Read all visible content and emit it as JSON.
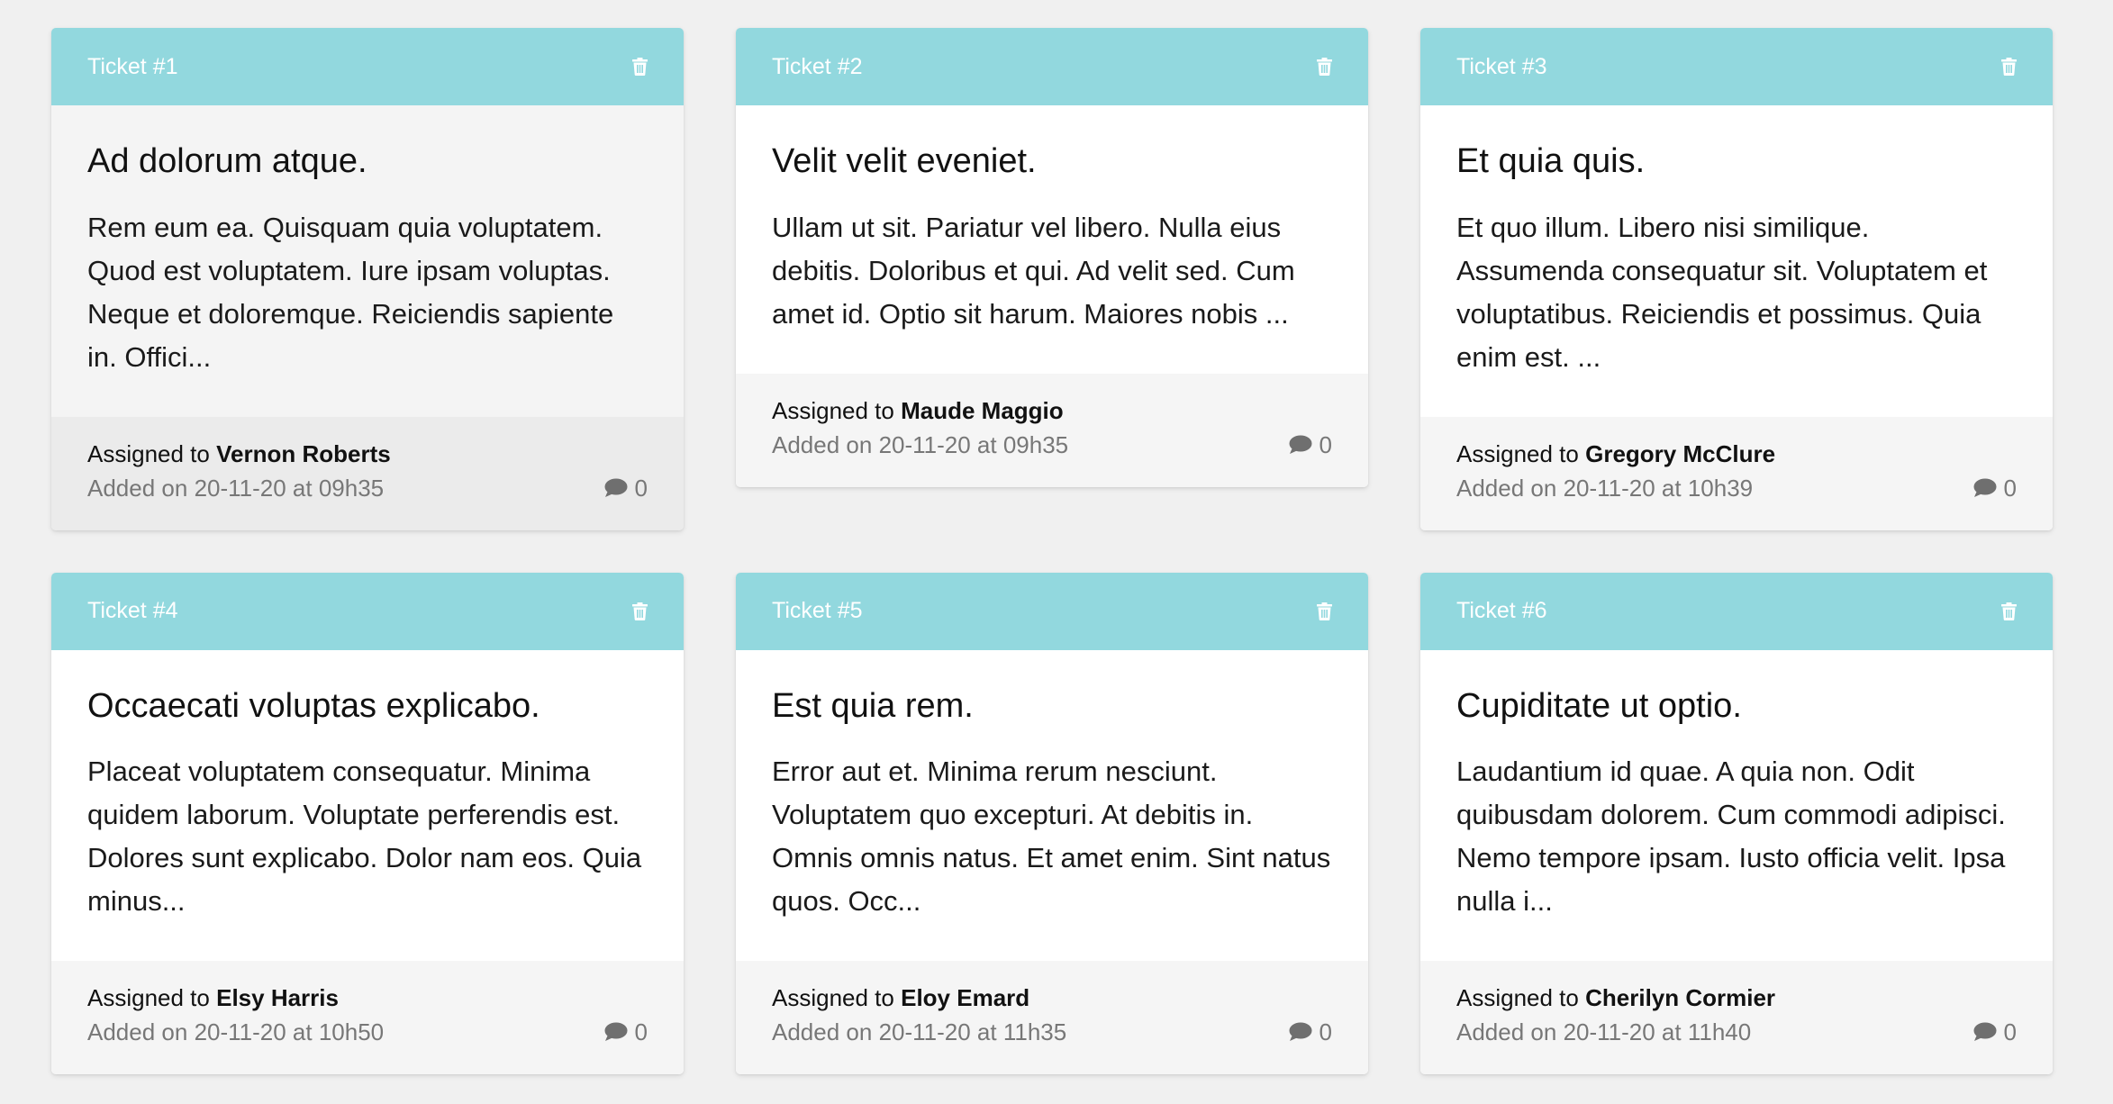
{
  "assigned_prefix": "Assigned to",
  "added_prefix": "Added on",
  "colors": {
    "header": "#92d8de",
    "page_background": "#f0f0f0",
    "footer": "#f5f5f5"
  },
  "tickets": [
    {
      "label": "Ticket #1",
      "title": "Ad dolorum atque.",
      "body": "Rem eum ea. Quisquam quia voluptatem. Quod est voluptatem. Iure ipsam voluptas. Neque et doloremque. Reiciendis sapiente in. Offici...",
      "assignee": "Vernon Roberts",
      "date": "20-11-20 at 09h35",
      "comments": "0",
      "icon": "trash-icon"
    },
    {
      "label": "Ticket #2",
      "title": "Velit velit eveniet.",
      "body": "Ullam ut sit. Pariatur vel libero. Nulla eius debitis. Doloribus et qui. Ad velit sed. Cum amet id. Optio sit harum. Maiores nobis ...",
      "assignee": "Maude Maggio",
      "date": "20-11-20 at 09h35",
      "comments": "0",
      "icon": "trash-icon"
    },
    {
      "label": "Ticket #3",
      "title": "Et quia quis.",
      "body": "Et quo illum. Libero nisi similique. Assumenda consequatur sit. Voluptatem et voluptatibus. Reiciendis et possimus. Quia enim est. ...",
      "assignee": "Gregory McClure",
      "date": "20-11-20 at 10h39",
      "comments": "0",
      "icon": "trash-icon"
    },
    {
      "label": "Ticket #4",
      "title": "Occaecati voluptas explicabo.",
      "body": "Placeat voluptatem consequatur. Minima quidem laborum. Voluptate perferendis est. Dolores sunt explicabo. Dolor nam eos. Quia minus...",
      "assignee": "Elsy Harris",
      "date": "20-11-20 at 10h50",
      "comments": "0",
      "icon": "trash-icon"
    },
    {
      "label": "Ticket #5",
      "title": "Est quia rem.",
      "body": "Error aut et. Minima rerum nesciunt. Voluptatem quo excepturi. At debitis in. Omnis omnis natus. Et amet enim. Sint natus quos. Occ...",
      "assignee": "Eloy Emard",
      "date": "20-11-20 at 11h35",
      "comments": "0",
      "icon": "trash-icon"
    },
    {
      "label": "Ticket #6",
      "title": "Cupiditate ut optio.",
      "body": "Laudantium id quae. A quia non. Odit quibusdam dolorem. Cum commodi adipisci. Nemo tempore ipsam. Iusto officia velit. Ipsa nulla i...",
      "assignee": "Cherilyn Cormier",
      "date": "20-11-20 at 11h40",
      "comments": "0",
      "icon": "trash-icon"
    }
  ]
}
